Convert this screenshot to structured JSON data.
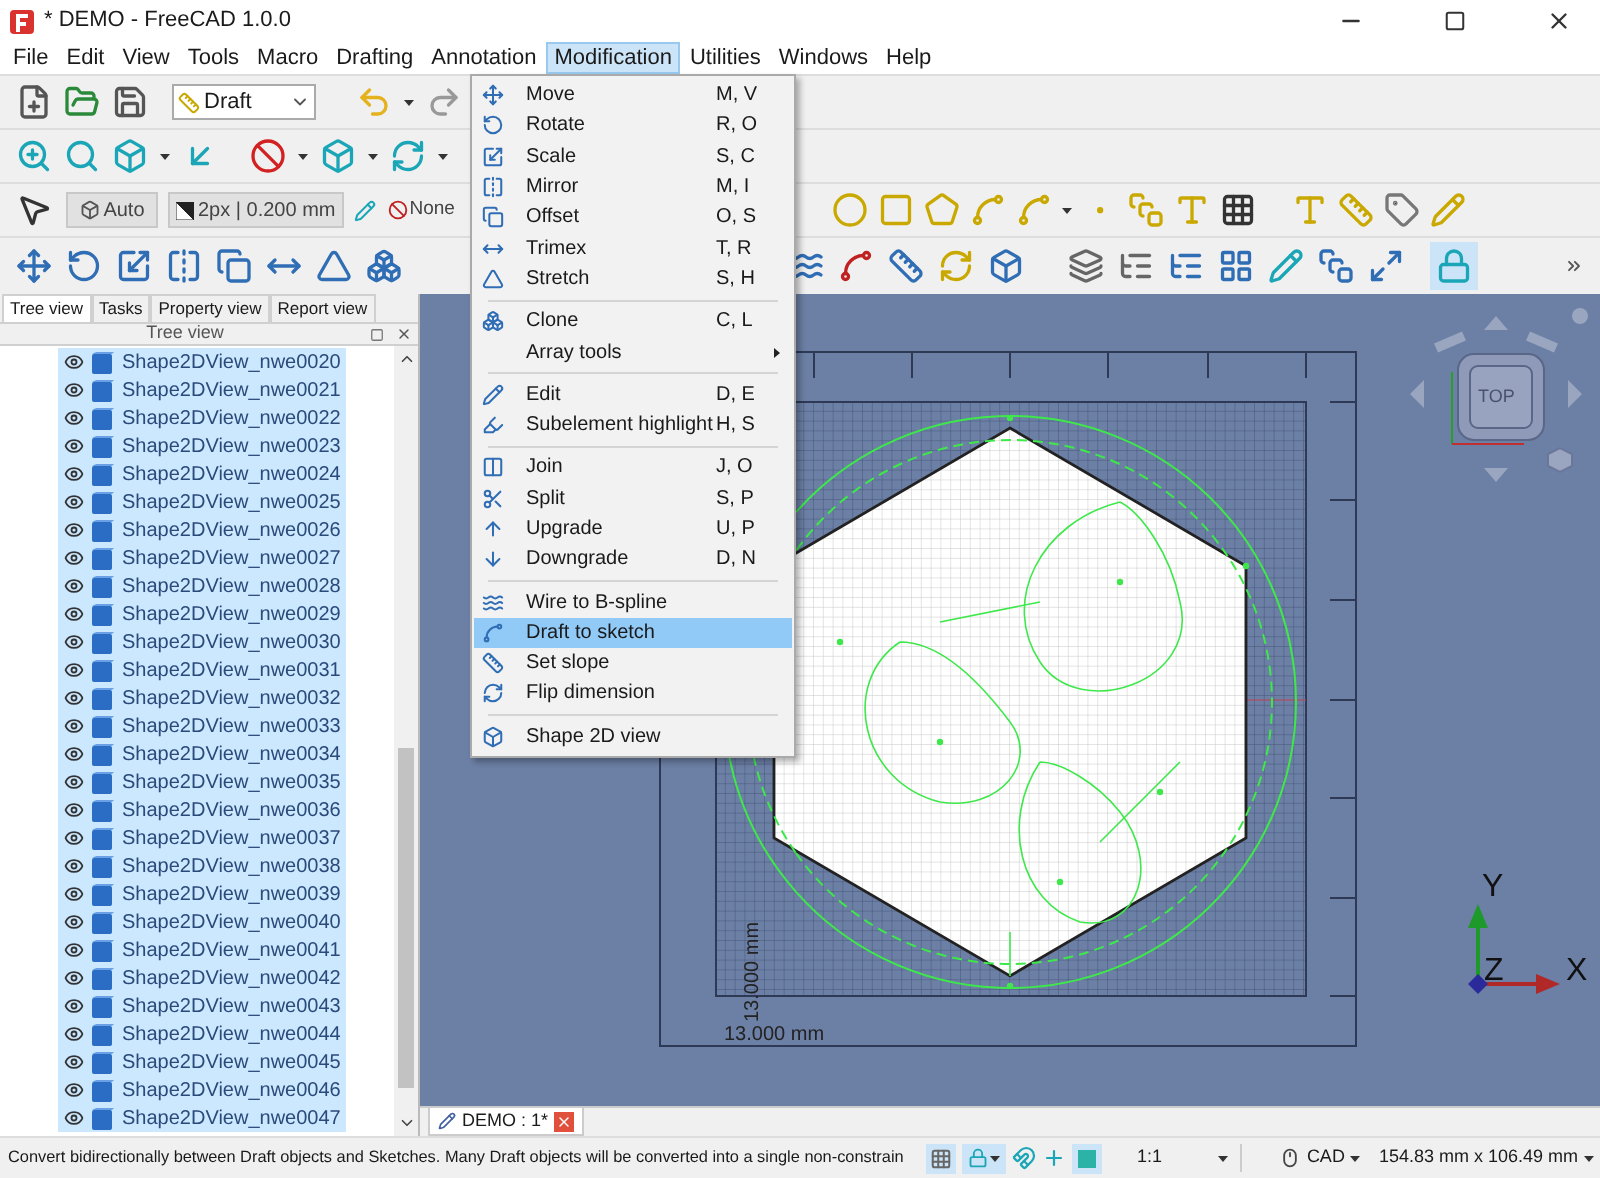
{
  "window": {
    "title": "* DEMO - FreeCAD 1.0.0"
  },
  "menu_bar": [
    {
      "label": "File",
      "selected": false
    },
    {
      "label": "Edit",
      "selected": false
    },
    {
      "label": "View",
      "selected": false
    },
    {
      "label": "Tools",
      "selected": false
    },
    {
      "label": "Macro",
      "selected": false
    },
    {
      "label": "Drafting",
      "selected": false
    },
    {
      "label": "Annotation",
      "selected": false
    },
    {
      "label": "Modification",
      "selected": true
    },
    {
      "label": "Utilities",
      "selected": false
    },
    {
      "label": "Windows",
      "selected": false
    },
    {
      "label": "Help",
      "selected": false
    }
  ],
  "toolbar": {
    "workbench": "Draft",
    "construction_mode": "Auto",
    "line_style": "2px | 0.200 mm",
    "fill_none": "None",
    "lock_on": true
  },
  "modification_menu": [
    {
      "kind": "item",
      "label": "Move",
      "shortcut": "M, V",
      "selected": false
    },
    {
      "kind": "item",
      "label": "Rotate",
      "shortcut": "R, O",
      "selected": false
    },
    {
      "kind": "item",
      "label": "Scale",
      "shortcut": "S, C",
      "selected": false
    },
    {
      "kind": "item",
      "label": "Mirror",
      "shortcut": "M, I",
      "selected": false
    },
    {
      "kind": "item",
      "label": "Offset",
      "shortcut": "O, S",
      "selected": false
    },
    {
      "kind": "item",
      "label": "Trimex",
      "shortcut": "T, R",
      "selected": false
    },
    {
      "kind": "item",
      "label": "Stretch",
      "shortcut": "S, H",
      "selected": false
    },
    {
      "kind": "separator"
    },
    {
      "kind": "item",
      "label": "Clone",
      "shortcut": "C, L",
      "selected": false
    },
    {
      "kind": "submenu",
      "label": "Array tools",
      "selected": false
    },
    {
      "kind": "separator"
    },
    {
      "kind": "item",
      "label": "Edit",
      "shortcut": "D, E",
      "selected": false
    },
    {
      "kind": "item",
      "label": "Subelement highlight",
      "shortcut": "H, S",
      "selected": false
    },
    {
      "kind": "separator"
    },
    {
      "kind": "item",
      "label": "Join",
      "shortcut": "J, O",
      "selected": false
    },
    {
      "kind": "item",
      "label": "Split",
      "shortcut": "S, P",
      "selected": false
    },
    {
      "kind": "item",
      "label": "Upgrade",
      "shortcut": "U, P",
      "selected": false
    },
    {
      "kind": "item",
      "label": "Downgrade",
      "shortcut": "D, N",
      "selected": false
    },
    {
      "kind": "separator"
    },
    {
      "kind": "item",
      "label": "Wire to B-spline",
      "selected": false
    },
    {
      "kind": "item",
      "label": "Draft to sketch",
      "selected": true
    },
    {
      "kind": "item",
      "label": "Set slope",
      "selected": false
    },
    {
      "kind": "item",
      "label": "Flip dimension",
      "selected": false
    },
    {
      "kind": "separator"
    },
    {
      "kind": "item",
      "label": "Shape 2D view",
      "selected": false
    }
  ],
  "combo_view": {
    "tabs": [
      {
        "label": "Tree view",
        "selected": true
      },
      {
        "label": "Tasks",
        "selected": false
      },
      {
        "label": "Property view",
        "selected": false
      },
      {
        "label": "Report view",
        "selected": false
      }
    ],
    "title": "Tree view",
    "items": [
      {
        "label": "Shape2DView_nwe0020",
        "selected": true
      },
      {
        "label": "Shape2DView_nwe0021",
        "selected": true
      },
      {
        "label": "Shape2DView_nwe0022",
        "selected": true
      },
      {
        "label": "Shape2DView_nwe0023",
        "selected": true
      },
      {
        "label": "Shape2DView_nwe0024",
        "selected": true
      },
      {
        "label": "Shape2DView_nwe0025",
        "selected": true
      },
      {
        "label": "Shape2DView_nwe0026",
        "selected": true
      },
      {
        "label": "Shape2DView_nwe0027",
        "selected": true
      },
      {
        "label": "Shape2DView_nwe0028",
        "selected": true
      },
      {
        "label": "Shape2DView_nwe0029",
        "selected": true
      },
      {
        "label": "Shape2DView_nwe0030",
        "selected": true
      },
      {
        "label": "Shape2DView_nwe0031",
        "selected": true
      },
      {
        "label": "Shape2DView_nwe0032",
        "selected": true
      },
      {
        "label": "Shape2DView_nwe0033",
        "selected": true
      },
      {
        "label": "Shape2DView_nwe0034",
        "selected": true
      },
      {
        "label": "Shape2DView_nwe0035",
        "selected": true
      },
      {
        "label": "Shape2DView_nwe0036",
        "selected": true
      },
      {
        "label": "Shape2DView_nwe0037",
        "selected": true
      },
      {
        "label": "Shape2DView_nwe0038",
        "selected": true
      },
      {
        "label": "Shape2DView_nwe0039",
        "selected": true
      },
      {
        "label": "Shape2DView_nwe0040",
        "selected": true
      },
      {
        "label": "Shape2DView_nwe0041",
        "selected": true
      },
      {
        "label": "Shape2DView_nwe0042",
        "selected": true
      },
      {
        "label": "Shape2DView_nwe0043",
        "selected": true
      },
      {
        "label": "Shape2DView_nwe0044",
        "selected": true
      },
      {
        "label": "Shape2DView_nwe0045",
        "selected": true
      },
      {
        "label": "Shape2DView_nwe0046",
        "selected": true
      },
      {
        "label": "Shape2DView_nwe0047",
        "selected": true
      }
    ]
  },
  "viewport": {
    "nav_cube_face": "TOP",
    "vertical_dimension": "13.000 mm",
    "horizontal_dimension": "13.000 mm",
    "axes": {
      "x": "X",
      "y": "Y",
      "z": "Z"
    }
  },
  "document_tabs": [
    {
      "label": "DEMO : 1*",
      "selected": true
    }
  ],
  "status_bar": {
    "grid_on": true,
    "snap_lock_on": true,
    "working_plane_on": true,
    "message": "Convert bidirectionally between Draft objects and Sketches. Many Draft objects will be converted into a single non-constrain",
    "scale": "1:1",
    "navigation": "CAD",
    "size": "154.83 mm x 106.49 mm"
  }
}
